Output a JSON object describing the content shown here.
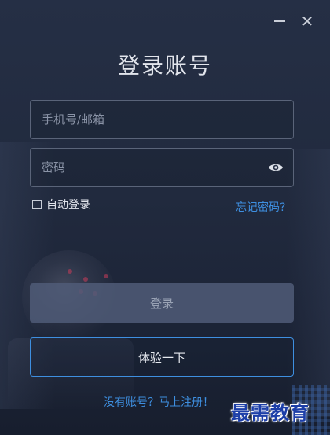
{
  "window": {
    "minimize_icon": "minimize-icon",
    "close_icon": "close-icon",
    "close_glyph": "✕"
  },
  "title": "登录账号",
  "form": {
    "phone_placeholder": "手机号/邮箱",
    "phone_value": "",
    "password_placeholder": "密码",
    "password_value": "",
    "password_icon": "eye-icon",
    "auto_login_label": "自动登录",
    "auto_login_checked": false,
    "forgot_label": "忘记密码?",
    "login_label": "登录",
    "trial_label": "体验一下",
    "register_label": "没有账号？马上注册！"
  },
  "watermark": "最需教育",
  "colors": {
    "accent": "#3e8fe0",
    "background": "#212a3e",
    "disabled_button": "#505c78",
    "watermark": "#1d3fa8"
  }
}
